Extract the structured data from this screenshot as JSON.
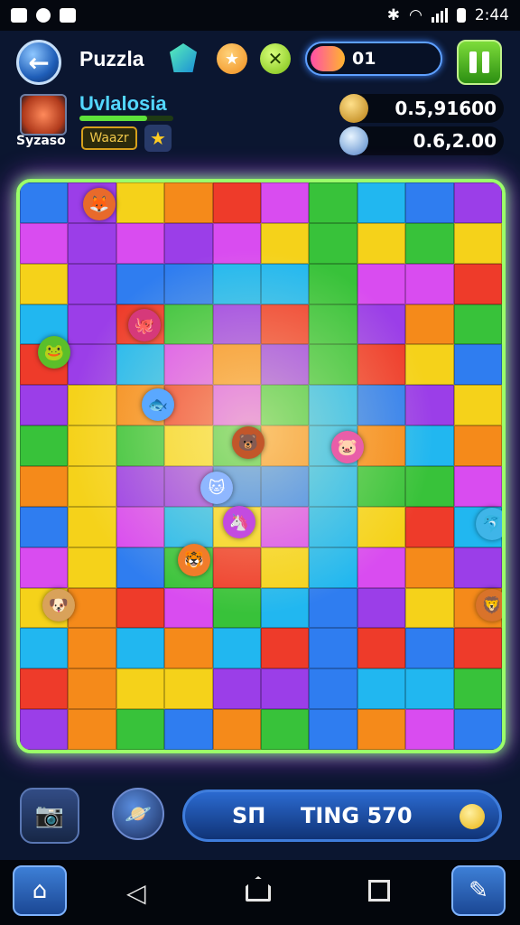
{
  "status_bar": {
    "time": "2:44",
    "left_icons": [
      "shield-icon",
      "location-icon",
      "image-icon"
    ],
    "right_icons": [
      "bluetooth-icon",
      "wifi-icon",
      "signal-icon",
      "battery-icon"
    ]
  },
  "header": {
    "title": "Puzzla",
    "counter_value": "01"
  },
  "player": {
    "avatar_label": "Syzaso",
    "name": "Uvlalosia",
    "badge": "Waazr",
    "xp_progress": 0.72
  },
  "stats": {
    "gold_value": "0.5,91600",
    "silver_value": "0.6,2.00"
  },
  "board": {
    "columns": 10,
    "rows": 14,
    "palette": [
      "#2f7df0",
      "#f58a1a",
      "#38c23a",
      "#9b3ee8",
      "#ee3b2a",
      "#21b7f0",
      "#f5d21a",
      "#d94cf0"
    ],
    "monsters": [
      {
        "emoji": "🦊",
        "color": "#e86a2b"
      },
      {
        "emoji": "🐙",
        "color": "#d6397a"
      },
      {
        "emoji": "🐸",
        "color": "#5bbf2a"
      },
      {
        "emoji": "🐟",
        "color": "#5aa8ff"
      },
      {
        "emoji": "🐻",
        "color": "#c2562a"
      },
      {
        "emoji": "🐷",
        "color": "#e95ea8"
      },
      {
        "emoji": "🐱",
        "color": "#8fb7ff"
      },
      {
        "emoji": "🦄",
        "color": "#c34be0"
      },
      {
        "emoji": "🐯",
        "color": "#f07c2a"
      },
      {
        "emoji": "🐶",
        "color": "#d9a25a"
      },
      {
        "emoji": "🦁",
        "color": "#d9732a"
      },
      {
        "emoji": "🐬",
        "color": "#3fb5e8"
      }
    ]
  },
  "bottom": {
    "start_text_1": "SП",
    "start_text_2": "TING 570"
  }
}
